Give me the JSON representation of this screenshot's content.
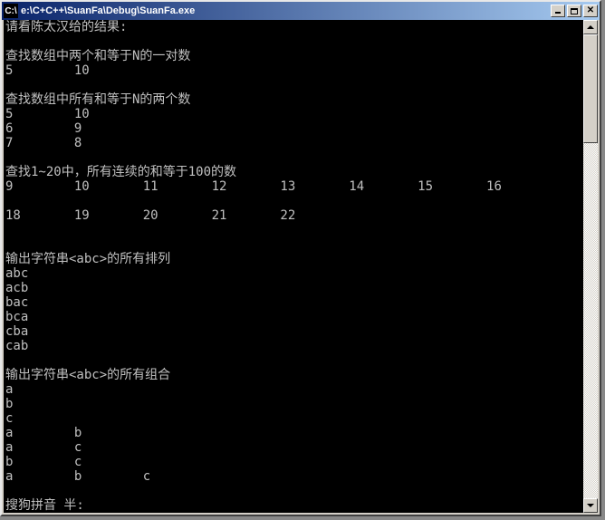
{
  "window": {
    "icon_text": "C:\\",
    "title": "e:\\C+C++\\SuanFa\\Debug\\SuanFa.exe"
  },
  "buttons": {
    "minimize": "Minimize",
    "maximize": "Maximize",
    "close": "Close"
  },
  "console": {
    "lines": [
      "请看陈太汉给的结果:",
      "",
      "查找数组中两个和等于N的一对数",
      "5        10",
      "",
      "查找数组中所有和等于N的两个数",
      "5        10",
      "6        9",
      "7        8",
      "",
      "查找1~20中，所有连续的和等于100的数",
      "9        10       11       12       13       14       15       16",
      "",
      "18       19       20       21       22",
      "",
      "",
      "输出字符串<abc>的所有排列",
      "abc",
      "acb",
      "bac",
      "bca",
      "cba",
      "cab",
      "",
      "输出字符串<abc>的所有组合",
      "a",
      "b",
      "c",
      "a        b",
      "a        c",
      "b        c",
      "a        b        c",
      "",
      "搜狗拼音 半:"
    ]
  }
}
